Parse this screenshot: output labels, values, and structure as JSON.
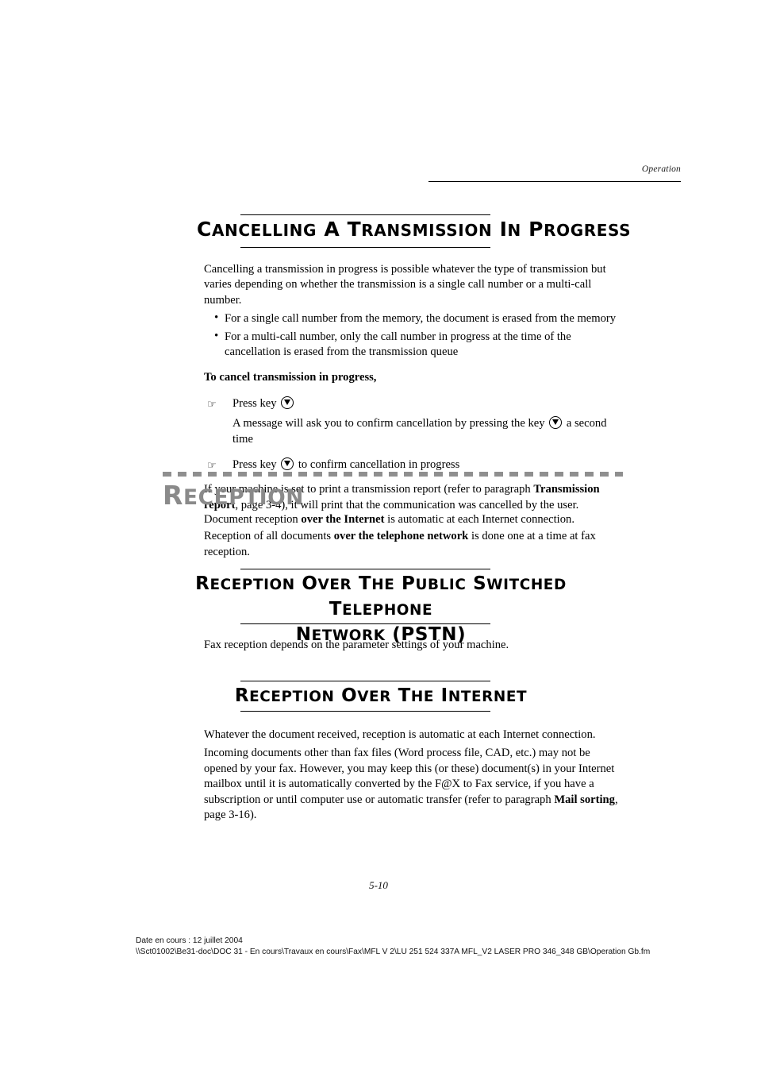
{
  "page": {
    "running_header": "Operation",
    "page_number": "5-10"
  },
  "section_cancelling": {
    "heading": "Cancelling a transmission in progress",
    "intro": "Cancelling a transmission in progress is possible whatever the type of transmission but varies depending on whether the transmission is a single call number or a multi-call number.",
    "bullets": [
      "For a single call number from the memory, the document is erased from the memory",
      "For a multi-call number, only the call number in progress at the time of the cancellation is erased from the transmission queue"
    ],
    "bullet_marker": "bullet-dot",
    "lead_in": "To cancel transmission in progress,",
    "step1_prefix": "Press key",
    "step1_note": "A message will ask you to confirm cancellation by pressing the key",
    "step1_note_suffix": "a second time",
    "step2_prefix": "Press key",
    "step2_suffix": "to confirm cancellation in progress",
    "closing_part1": "If your machine is set to print a transmission report (refer to paragraph ",
    "closing_bold": "Transmission report",
    "closing_part2": ", page 3-4), it will print that the communication was cancelled by the user.",
    "hand_marker": "hand-pointer-icon",
    "key_icon": "stop-key-icon"
  },
  "chapter_reception": {
    "title": "Reception",
    "accent_color": "#8a8a8a",
    "line1_part1": "Document reception ",
    "line1_bold": "over the Internet",
    "line1_part2": " is automatic at each Internet connection.",
    "line2_part1": "Reception of all documents ",
    "line2_bold": "over the telephone network",
    "line2_part2": " is done one at a time at fax reception."
  },
  "section_pstn": {
    "heading_line1": "Reception over the Public Switched Telephone",
    "heading_line2": "Network (PSTN)",
    "body": "Fax reception depends on the parameter settings of your machine."
  },
  "section_internet": {
    "heading": "Reception over the Internet",
    "para1": "Whatever the document received, reception is automatic at each Internet connection.",
    "para2_part1": "Incoming documents other than fax files (Word process file, CAD, etc.) may not be opened by your fax. However, you may keep this (or these) document(s) in your Internet mailbox until it is automatically converted by the F@X to Fax service, if you have a subscription or until computer use or automatic transfer (refer to paragraph ",
    "para2_bold": "Mail sorting",
    "para2_part2": ", page 3-16)."
  },
  "footer": {
    "date_line": "Date en cours : 12 juillet 2004",
    "path_line": "\\\\Sct01002\\Be31-doc\\DOC 31 - En cours\\Travaux en cours\\Fax\\MFL V 2\\LU 251 524 337A MFL_V2 LASER PRO 346_348 GB\\Operation Gb.fm"
  }
}
